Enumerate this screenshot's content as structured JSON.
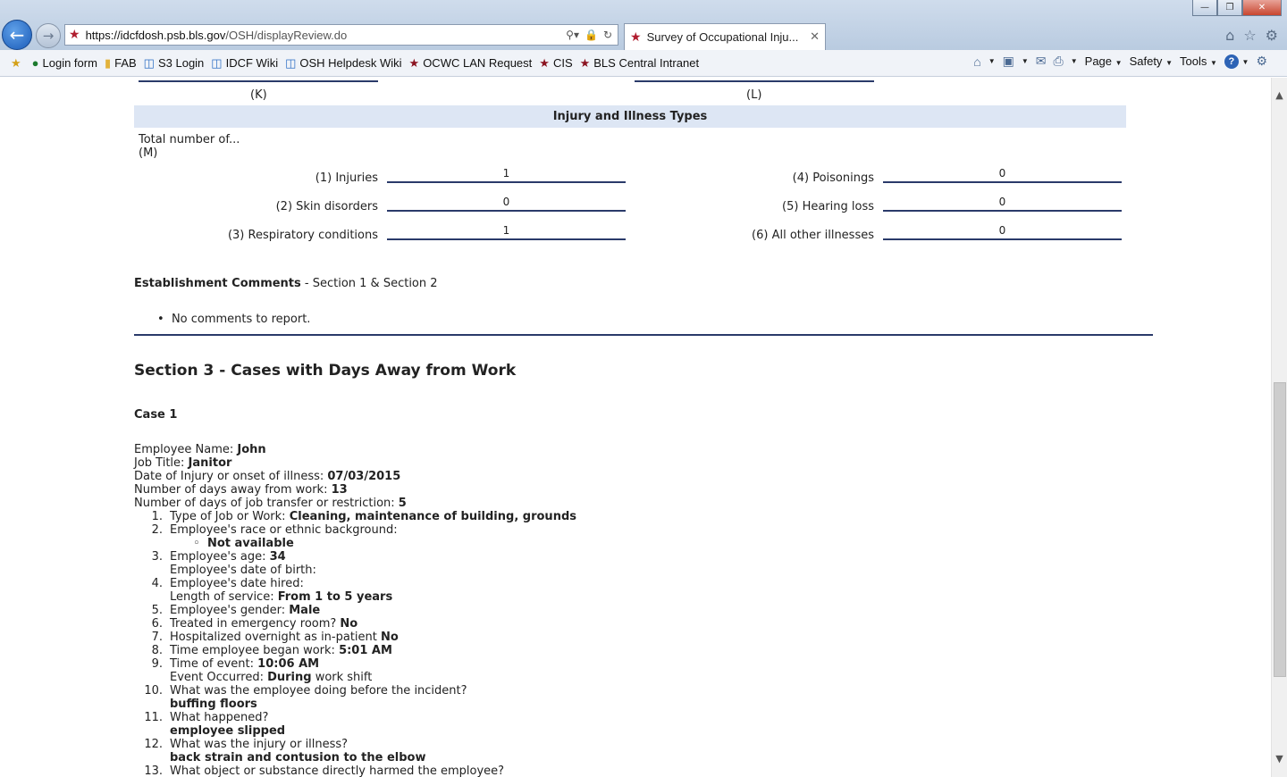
{
  "browser": {
    "url_main": "https://idcfdosh.psb.bls.gov",
    "url_path": "/OSH/displayReview.do",
    "tab_title": "Survey of Occupational Inju...",
    "window_controls": [
      "minimize-icon",
      "restore-icon",
      "close-icon"
    ],
    "favorites": [
      {
        "label": "Login form",
        "icon": "globe-icon"
      },
      {
        "label": "FAB",
        "icon": "folder-icon"
      },
      {
        "label": "S3 Login",
        "icon": "ie-page-icon"
      },
      {
        "label": "IDCF Wiki",
        "icon": "ie-page-icon"
      },
      {
        "label": "OSH Helpdesk Wiki",
        "icon": "ie-page-icon"
      },
      {
        "label": "OCWC LAN Request",
        "icon": "bls-star-icon"
      },
      {
        "label": "CIS",
        "icon": "bls-star-icon"
      },
      {
        "label": "BLS Central Intranet",
        "icon": "bls-star-icon"
      }
    ],
    "commands": {
      "page": "Page",
      "safety": "Safety",
      "tools": "Tools"
    }
  },
  "top_fields": {
    "k_label": "(K)",
    "l_label": "(L)"
  },
  "injury_types": {
    "heading": "Injury and Illness Types",
    "total_label": "Total number of...",
    "m_label": "(M)",
    "left": [
      {
        "label": "(1) Injuries",
        "value": "1"
      },
      {
        "label": "(2) Skin disorders",
        "value": "0"
      },
      {
        "label": "(3) Respiratory conditions",
        "value": "1"
      }
    ],
    "right": [
      {
        "label": "(4) Poisonings",
        "value": "0"
      },
      {
        "label": "(5) Hearing loss",
        "value": "0"
      },
      {
        "label": "(6) All other illnesses",
        "value": "0"
      }
    ]
  },
  "comments": {
    "title": "Establishment Comments",
    "subtitle": " - Section 1 & Section 2",
    "items": [
      "No comments to report."
    ]
  },
  "section3": {
    "title": "Section 3 - Cases with Days Away from Work",
    "case_title": "Case 1",
    "employee_name_label": "Employee Name: ",
    "employee_name": "John",
    "job_title_label": "Job Title: ",
    "job_title": "Janitor",
    "injury_date_label": "Date of Injury or onset of illness: ",
    "injury_date": "07/03/2015",
    "days_away_label": "Number of days away from work: ",
    "days_away": "13",
    "days_transfer_label": "Number of days of job transfer or restriction: ",
    "days_transfer": "5",
    "q1_label": "Type of Job or Work: ",
    "q1_value": "Cleaning, maintenance of building, grounds",
    "q2_label": "Employee's race or ethnic background:",
    "q2_value": "Not available",
    "q3_label": "Employee's age: ",
    "q3_value": "34",
    "q3_dob_label": "Employee's date of birth:",
    "q4_label": "Employee's date hired:",
    "q4_los_label": "Length of service: ",
    "q4_los_value": "From 1 to 5 years",
    "q5_label": "Employee's gender: ",
    "q5_value": "Male",
    "q6_label": "Treated in emergency room? ",
    "q6_value": "No",
    "q7_label": "Hospitalized overnight as in-patient ",
    "q7_value": "No",
    "q8_label": "Time employee began work: ",
    "q8_value": "5:01 AM",
    "q9_label": "Time of event: ",
    "q9_value": "10:06 AM",
    "q9_occ_label": "Event Occurred: ",
    "q9_occ_value": "During",
    "q9_occ_suffix": " work shift",
    "q10_label": "What was the employee doing before the incident?",
    "q10_value": "buffing floors",
    "q11_label": "What happened?",
    "q11_value": "employee slipped",
    "q12_label": "What was the injury or illness?",
    "q12_value": "back strain and contusion to the elbow",
    "q13_label": "What object or substance directly harmed the employee?",
    "numbers": [
      "1.",
      "2.",
      "3.",
      "4.",
      "5.",
      "6.",
      "7.",
      "8.",
      "9.",
      "10.",
      "11.",
      "12.",
      "13."
    ]
  }
}
